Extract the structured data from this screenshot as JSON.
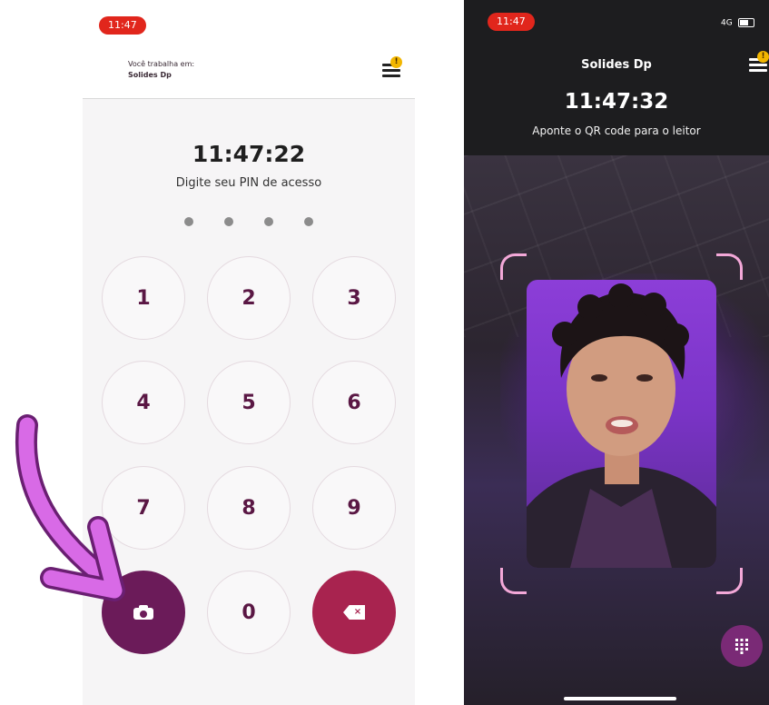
{
  "colors": {
    "brand_purple": "#6b1b59",
    "delete_red": "#a8234f",
    "digit_color": "#5a1744",
    "status_red": "#e1261c",
    "notice_yellow": "#f2b600",
    "arrow_pink": "#d86ae6",
    "scan_corner": "#f3a8d8"
  },
  "left_screen": {
    "status_time": "11:47",
    "work_label": "Você trabalha em:",
    "company": "Solides Dp",
    "menu_icon": "hamburger-menu-icon",
    "notice_badge": "!",
    "clock": "11:47:22",
    "prompt": "Digite seu PIN de acesso",
    "pin_length": 4,
    "keys": {
      "k1": "1",
      "k2": "2",
      "k3": "3",
      "k4": "4",
      "k5": "5",
      "k6": "6",
      "k7": "7",
      "k8": "8",
      "k9": "9",
      "k0": "0"
    },
    "camera_key_icon": "camera-icon",
    "delete_key_icon": "backspace-icon",
    "delete_key_x": "×"
  },
  "annotation": {
    "arrow_icon": "curved-arrow-icon"
  },
  "right_screen": {
    "status_time": "11:47",
    "network": "4G",
    "battery_icon": "battery-icon",
    "company": "Solides Dp",
    "notice_badge": "!",
    "clock": "11:47:32",
    "prompt": "Aponte o QR code para o leitor",
    "keypad_button_icon": "keypad-icon"
  }
}
